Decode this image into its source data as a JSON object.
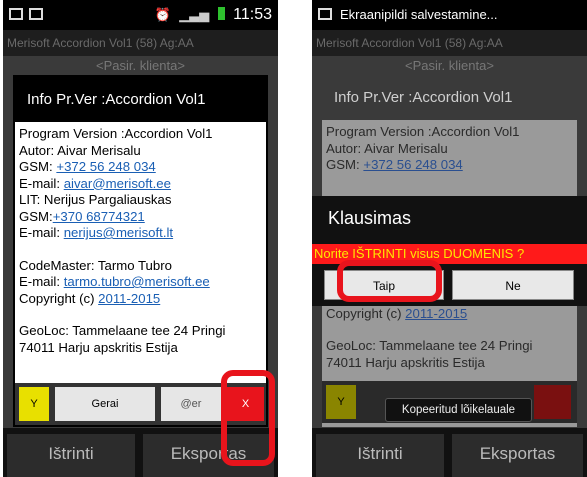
{
  "colors": {
    "accent_red": "#e8141c",
    "yellow": "#e8e000",
    "link": "#1a5fb4",
    "warning_bg": "#ff1a1a",
    "warning_text": "#ffe800"
  },
  "left": {
    "status": {
      "time": "11:53"
    },
    "app_title": "Merisoft Accordion Vol1 (58) Ag:AA",
    "bg_pick": "<Pasir. klienta>",
    "dialog": {
      "title": "Info  Pr.Ver :Accordion Vol1",
      "lines": {
        "l1": "Program Version :Accordion Vol1",
        "l2": "Autor: Aivar Merisalu",
        "l3_label": "GSM: ",
        "l3_link": "+372 56 248 034",
        "l4_label": "E-mail: ",
        "l4_link": "aivar@merisoft.ee",
        "l5": "LIT: Nerijus Pargaliauskas",
        "l6_label": "GSM:",
        "l6_link": "+370 68774321",
        "l7_label": "E-mail: ",
        "l7_link": "nerijus@merisoft.lt",
        "l8": "CodeMaster: Tarmo Tubro",
        "l9_label": " E-mail: ",
        "l9_link": "tarmo.tubro@merisoft.ee",
        "l10_label": "Copyright (c) ",
        "l10_link": "2011-2015",
        "l11": "GeoLoc: Tammelaane tee 24 Pringi",
        "l12": "74011 Harju apskritis Estija"
      },
      "buttons": {
        "y": "Y",
        "ok": "Gerai",
        "email": "@er",
        "x": "X"
      }
    },
    "bottom": {
      "delete": "Ištrinti",
      "export": "Eksportas"
    }
  },
  "right": {
    "status": {
      "saving": "Ekraanipildi salvestamine..."
    },
    "app_title": "Merisoft Accordion Vol1 (58) Ag:AA",
    "bg_pick": "<Pasir. klienta>",
    "dialog_title": "Info  Pr.Ver :Accordion Vol1",
    "bg_lines": {
      "l1": "Program Version :Accordion Vol1",
      "l2": "Autor: Aivar Merisalu",
      "l3_label": "GSM: ",
      "l3_link": "+372 56 248 034",
      "l10_label": "Copyright (c) ",
      "l10_link": "2011-2015",
      "l11": "GeoLoc: Tammelaane tee 24 Pringi",
      "l12": "74011 Harju apskritis Estija"
    },
    "confirm": {
      "title": "Klausimas",
      "message": "Norite IŠTRINTI visus DUOMENIS ?",
      "yes": "Taip",
      "no": "Ne"
    },
    "y_button": "Y",
    "toast": "Kopeeritud lõikelauale",
    "bottom": {
      "delete": "Ištrinti",
      "export": "Eksportas"
    }
  }
}
